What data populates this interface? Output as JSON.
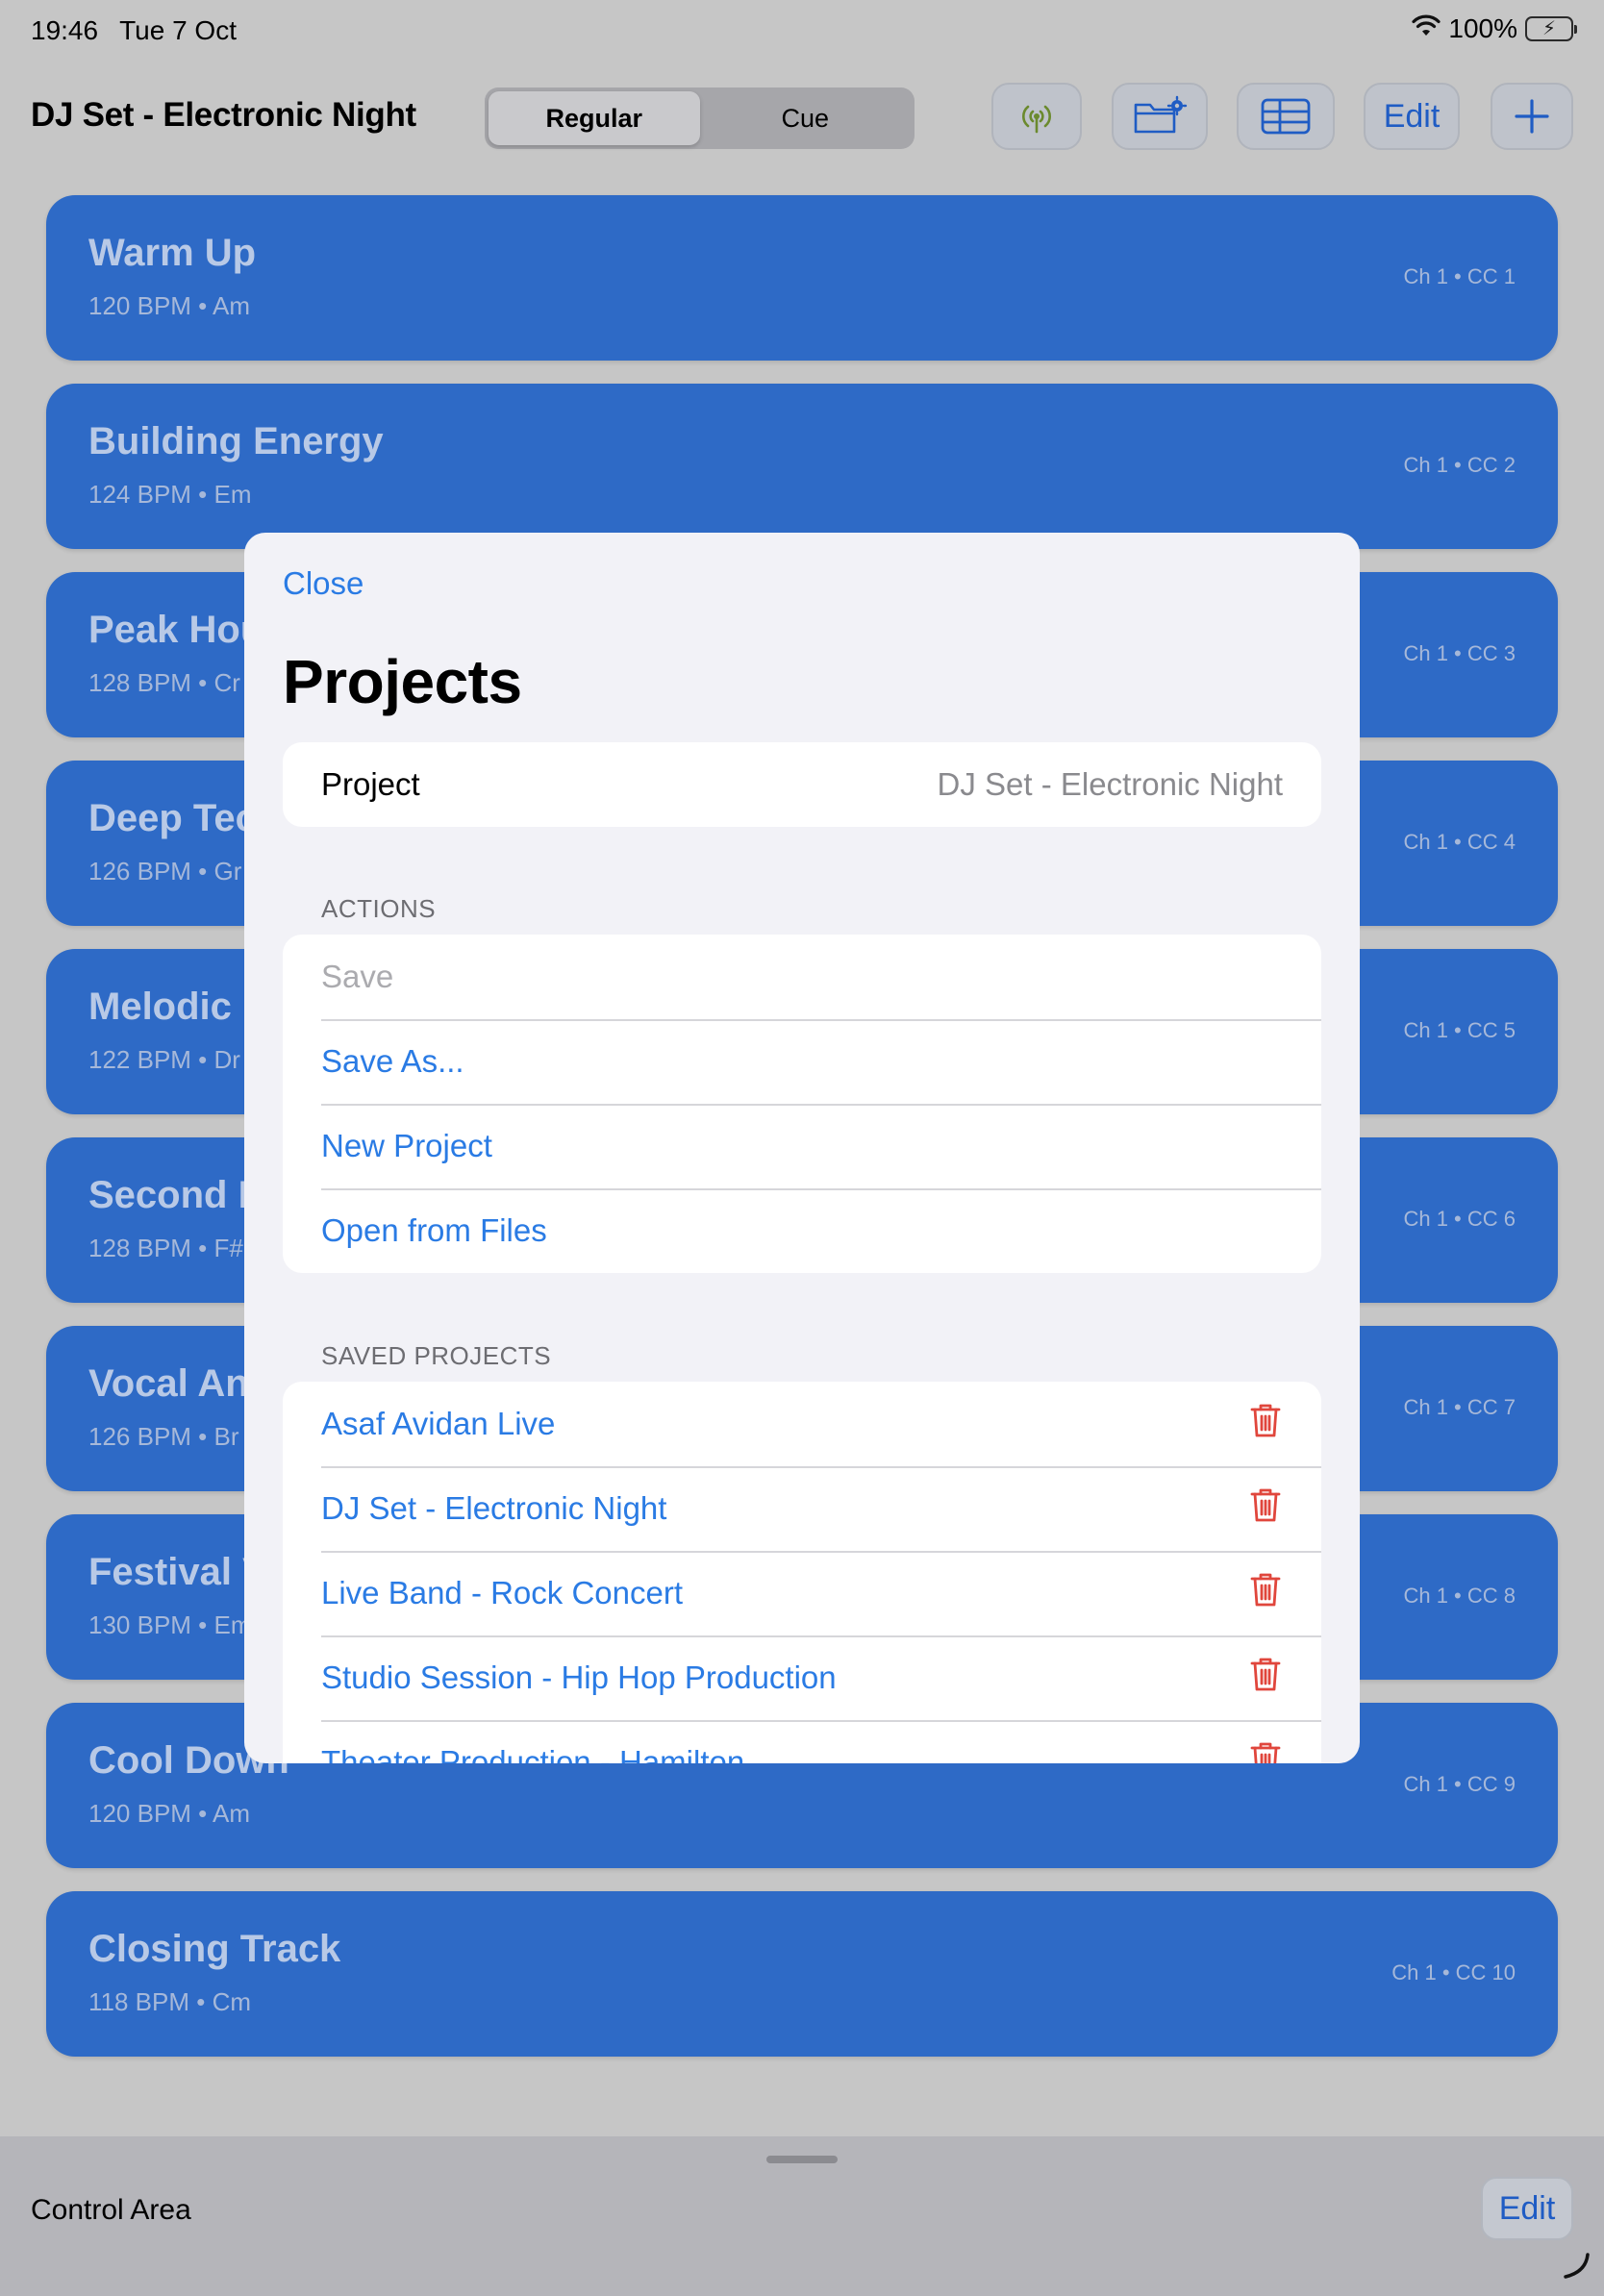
{
  "status_bar": {
    "time": "19:46",
    "date": "Tue 7 Oct",
    "battery": "100%"
  },
  "nav": {
    "title": "DJ Set - Electronic Night",
    "segments": [
      "Regular",
      "Cue"
    ],
    "selected_segment": "Regular",
    "edit_label": "Edit",
    "icons": [
      "antenna-icon",
      "folder-settings-icon",
      "table-icon",
      "plus-icon"
    ]
  },
  "cues": [
    {
      "title": "Warm Up",
      "subtitle": "120 BPM • Am",
      "channel": "Ch 1  •  CC 1"
    },
    {
      "title": "Building Energy",
      "subtitle": "124 BPM • Em",
      "channel": "Ch 1  •  CC 2"
    },
    {
      "title": "Peak Hou",
      "subtitle": "128 BPM • Cr",
      "channel": "Ch 1  •  CC 3"
    },
    {
      "title": "Deep Tec",
      "subtitle": "126 BPM • Gr",
      "channel": "Ch 1  •  CC 4"
    },
    {
      "title": "Melodic I",
      "subtitle": "122 BPM • Dr",
      "channel": "Ch 1  •  CC 5"
    },
    {
      "title": "Second D",
      "subtitle": "128 BPM • F#",
      "channel": "Ch 1  •  CC 6"
    },
    {
      "title": "Vocal An",
      "subtitle": "126 BPM • Br",
      "channel": "Ch 1  •  CC 7"
    },
    {
      "title": "Festival V",
      "subtitle": "130 BPM • Em",
      "channel": "Ch 1  •  CC 8"
    },
    {
      "title": "Cool Down",
      "subtitle": "120 BPM • Am",
      "channel": "Ch 1  •  CC 9"
    },
    {
      "title": "Closing Track",
      "subtitle": "118 BPM • Cm",
      "channel": "Ch 1  •  CC 10"
    }
  ],
  "control_area": {
    "title": "Control Area",
    "edit_label": "Edit"
  },
  "sheet": {
    "close_label": "Close",
    "title": "Projects",
    "project": {
      "label": "Project",
      "value": "DJ Set - Electronic Night"
    },
    "actions_header": "ACTIONS",
    "actions": [
      "Save",
      "Save As...",
      "New Project",
      "Open from Files"
    ],
    "saved_header": "SAVED PROJECTS",
    "saved_projects": [
      "Asaf Avidan Live",
      "DJ Set - Electronic Night",
      "Live Band - Rock Concert",
      "Studio Session - Hip Hop Production",
      "Theater Production - Hamilton"
    ]
  },
  "colors": {
    "accent": "#2a7be4",
    "cue_background": "#2e6ac6",
    "delete": "#e0463c",
    "battery": "#34c759"
  }
}
